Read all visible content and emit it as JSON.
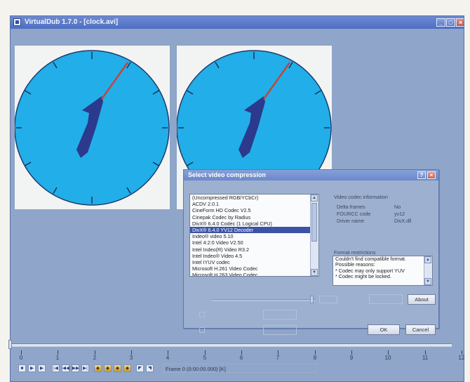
{
  "window": {
    "title": "VirtualDub 1.7.0 - [clock.avi]",
    "min_label": "_",
    "max_label": "□",
    "close_label": "×"
  },
  "clock": {
    "face_color": "#22aee8",
    "hand_color": "#c6423a",
    "numeral_color": "#2b3a8c",
    "pane_bg": "#f2f4f4"
  },
  "dialog": {
    "title": "Select video compression",
    "help_label": "?",
    "close_label": "×",
    "codecs": [
      "(Uncompressed RGB/YCbCr)",
      "ACDV 2.0.1",
      "CineForm HD Codec V2.5",
      "Cinepak Codec by Radius",
      "DivX® 6.4.0 Codec (1 Logical CPU)",
      "DivX® 6.4.0 YV12 Decoder",
      "Indeo® video 5.10",
      "Intel 4:2:0 Video V2.50",
      "Intel Indeo(R) Video R3.2",
      "Intel Indeo® Video 4.5",
      "Intel IYUV codec",
      "Microsoft H.261 Video Codec",
      "Microsoft H.263 Video Codec"
    ],
    "selected_index": 5,
    "info": {
      "group_label": "Video codec information",
      "delta_frames_label": "Delta frames",
      "delta_frames_value": "No",
      "fourcc_label": "FOURCC code",
      "fourcc_value": "yv12",
      "driver_label": "Driver name",
      "driver_value": "DivX.dll"
    },
    "restrictions": {
      "group_label": "Format restrictions",
      "lines": [
        "Couldn't find compatible format.",
        "Possible reasons:",
        "* Codec may only support YUV",
        "* Codec might be locked."
      ]
    },
    "about_label": "About",
    "ok_label": "OK",
    "cancel_label": "Cancel"
  },
  "timeline": {
    "ticks": [
      "0",
      "1",
      "2",
      "3",
      "4",
      "5",
      "6",
      "7",
      "8",
      "9",
      "10",
      "11",
      "12"
    ]
  },
  "status": {
    "frame_text": "Frame 0 (0:00:00.000) [K]"
  }
}
